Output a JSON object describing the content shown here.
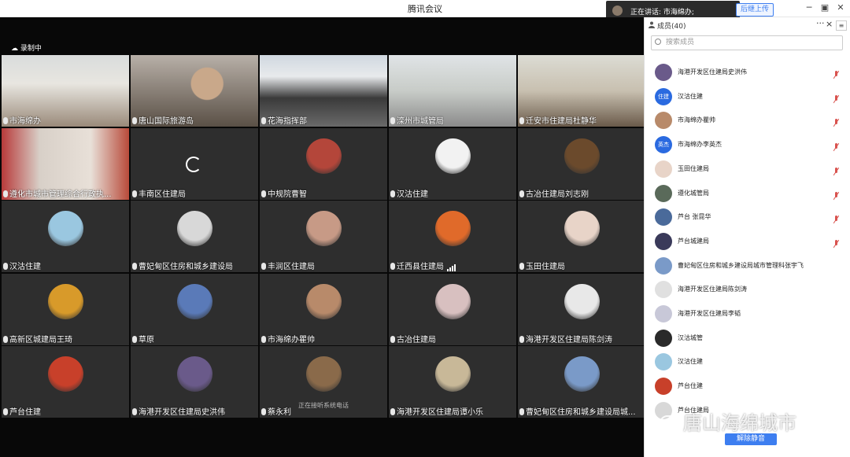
{
  "window": {
    "title": "腾讯会议"
  },
  "speaking": {
    "text": "正在讲话: 市海绵办;"
  },
  "upload_button": "后继上传",
  "recording": {
    "label": "录制中"
  },
  "tiles": [
    {
      "name": "市海绵办",
      "kind": "photo",
      "scene": "office1"
    },
    {
      "name": "唐山国际旅游岛",
      "kind": "photo",
      "scene": "face"
    },
    {
      "name": "花海指挥部",
      "kind": "photo",
      "scene": "meeting"
    },
    {
      "name": "滦州市城管局",
      "kind": "photo",
      "scene": "room"
    },
    {
      "name": "迁安市住建局杜静华",
      "kind": "photo",
      "scene": "office2"
    },
    {
      "name": "遵化市城市管理综合行政执...",
      "kind": "photo",
      "scene": "wall"
    },
    {
      "name": "丰南区住建局",
      "kind": "loading"
    },
    {
      "name": "中规院曹智",
      "kind": "avatar",
      "color": "#b4463a"
    },
    {
      "name": "汉沽住建",
      "kind": "avatar",
      "color": "#f2f2f2"
    },
    {
      "name": "古冶住建局刘志刚",
      "kind": "avatar",
      "color": "#6b4a2c"
    },
    {
      "name": "汉沽住建",
      "kind": "avatar",
      "color": "#9ac7e0"
    },
    {
      "name": "曹妃甸区住房和城乡建设局",
      "kind": "avatar",
      "color": "#d8d8d8"
    },
    {
      "name": "丰润区住建局",
      "kind": "avatar",
      "color": "#c79a86"
    },
    {
      "name": "迁西县住建局",
      "kind": "avatar",
      "color": "#e06a2a",
      "signal": true
    },
    {
      "name": "玉田住建局",
      "kind": "avatar",
      "color": "#e8d4c8"
    },
    {
      "name": "高新区城建局王琦",
      "kind": "avatar",
      "color": "#d89a2a"
    },
    {
      "name": "草原",
      "kind": "avatar",
      "color": "#5a7ab8"
    },
    {
      "name": "市海绵办瞿帅",
      "kind": "avatar",
      "color": "#b88a6a"
    },
    {
      "name": "古冶住建局",
      "kind": "avatar",
      "color": "#d8c0c0"
    },
    {
      "name": "海港开发区住建局陈剑涛",
      "kind": "avatar",
      "color": "#e8e8e8"
    },
    {
      "name": "芦台住建",
      "kind": "avatar",
      "color": "#c8402a"
    },
    {
      "name": "海港开发区住建局史洪伟",
      "kind": "avatar",
      "color": "#6a5a8a"
    },
    {
      "name": "蔡永利",
      "kind": "call",
      "color": "#8a6a4a",
      "sub": "正在接听系统电话"
    },
    {
      "name": "海港开发区住建局谭小乐",
      "kind": "avatar",
      "color": "#c8b898"
    },
    {
      "name": "曹妃甸区住房和城乡建设局城...",
      "kind": "avatar",
      "color": "#7a9ac8"
    }
  ],
  "panel": {
    "title": "成员(40)",
    "search_placeholder": "搜索成员",
    "more": "···",
    "close": "×",
    "members": [
      {
        "name": "海港开发区住建局史洪伟",
        "color": "#6a5a8a"
      },
      {
        "name": "汉沽住建",
        "color": "#2a6ae0",
        "initials": "住建"
      },
      {
        "name": "市海绵办瞿帅",
        "color": "#b88a6a"
      },
      {
        "name": "市海绵办李英杰",
        "color": "#2a6ae0",
        "initials": "英杰"
      },
      {
        "name": "玉田住建局",
        "color": "#e8d4c8"
      },
      {
        "name": "遵化城管局",
        "color": "#5a6a5a"
      },
      {
        "name": "芦台 张昆华",
        "color": "#4a6a9a"
      },
      {
        "name": "芦台城建局",
        "color": "#3a3a5a"
      },
      {
        "name": "曹妃甸区住房和城乡建设局城市管理科张宇飞",
        "color": "#7a9ac8"
      },
      {
        "name": "海港开发区住建局陈剑涛",
        "color": "#e0e0e0"
      },
      {
        "name": "海港开发区住建局李韬",
        "color": "#c8c8d8"
      },
      {
        "name": "汉沽城管",
        "color": "#2a2a2a"
      },
      {
        "name": "汉沽住建",
        "color": "#9ac7e0"
      },
      {
        "name": "芦台住建",
        "color": "#c8402a"
      },
      {
        "name": "芦台住建局",
        "color": "#d8d8d8"
      }
    ],
    "unmute_all": "解除静音"
  },
  "watermark": "唐山海绵城市"
}
